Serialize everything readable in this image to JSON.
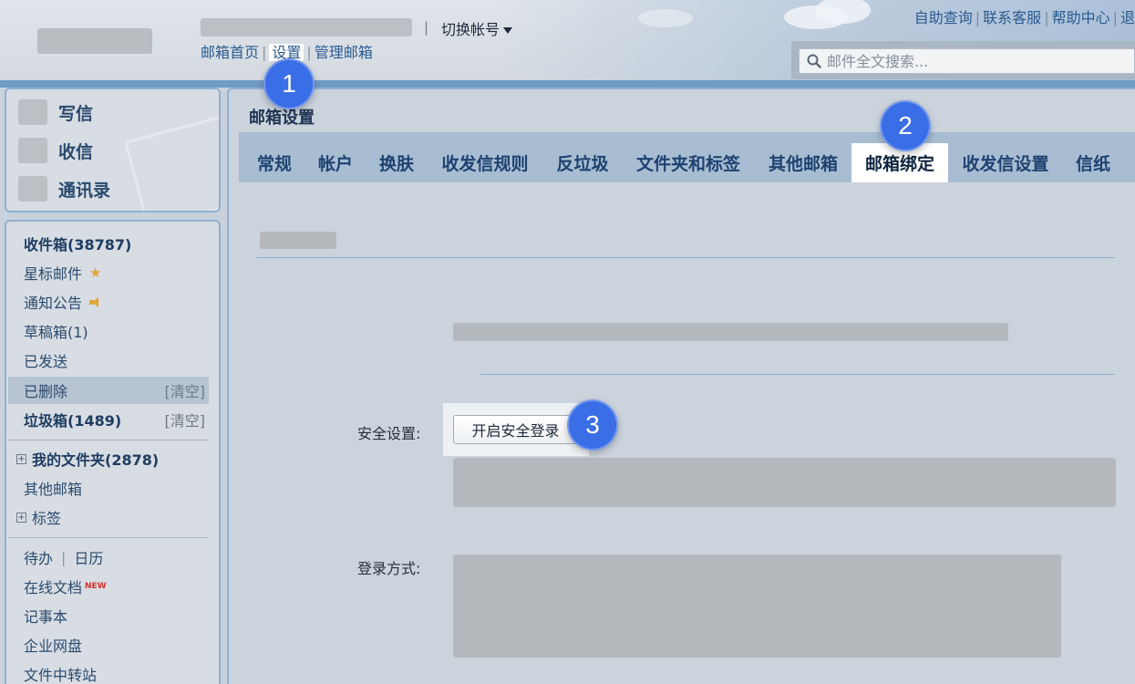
{
  "header": {
    "switch_account": "切换帐号",
    "account_separator": "|",
    "nav": {
      "home": "邮箱首页",
      "settings": "设置",
      "manage": "管理邮箱",
      "sep": "|"
    },
    "top_links": [
      "自助查询",
      "联系客服",
      "帮助中心",
      "退"
    ],
    "top_links_sep": "|",
    "search_placeholder": "邮件全文搜索..."
  },
  "sidebar": {
    "compose": "写信",
    "inbox_action": "收信",
    "contacts": "通讯录",
    "folders": {
      "inbox": "收件箱(38787)",
      "starred": "星标邮件",
      "notices": "通知公告",
      "drafts": "草稿箱(1)",
      "sent": "已发送",
      "deleted": "已删除",
      "spam": "垃圾箱(1489)",
      "clear": "[清空]",
      "my_folders": "我的文件夹(2878)",
      "other_mailboxes": "其他邮箱",
      "tags": "标签"
    },
    "tools": {
      "todo": "待办",
      "calendar": "日历",
      "tools_sep": "|",
      "docs": "在线文档",
      "docs_badge": "NEW",
      "notes": "记事本",
      "netdisk": "企业网盘",
      "transfer": "文件中转站"
    }
  },
  "main": {
    "title": "邮箱设置",
    "tabs": [
      "常规",
      "帐户",
      "换肤",
      "收发信规则",
      "反垃圾",
      "文件夹和标签",
      "其他邮箱",
      "邮箱绑定",
      "收发信设置",
      "信纸"
    ],
    "active_tab": "邮箱绑定",
    "security_label": "安全设置:",
    "security_button": "开启安全登录",
    "login_method_label": "登录方式:"
  },
  "markers": [
    "1",
    "2",
    "3"
  ],
  "colors": {
    "accent_blue": "#3a6ee6",
    "link": "#2a5b8f",
    "tab_bar": "#a8bdd2"
  }
}
